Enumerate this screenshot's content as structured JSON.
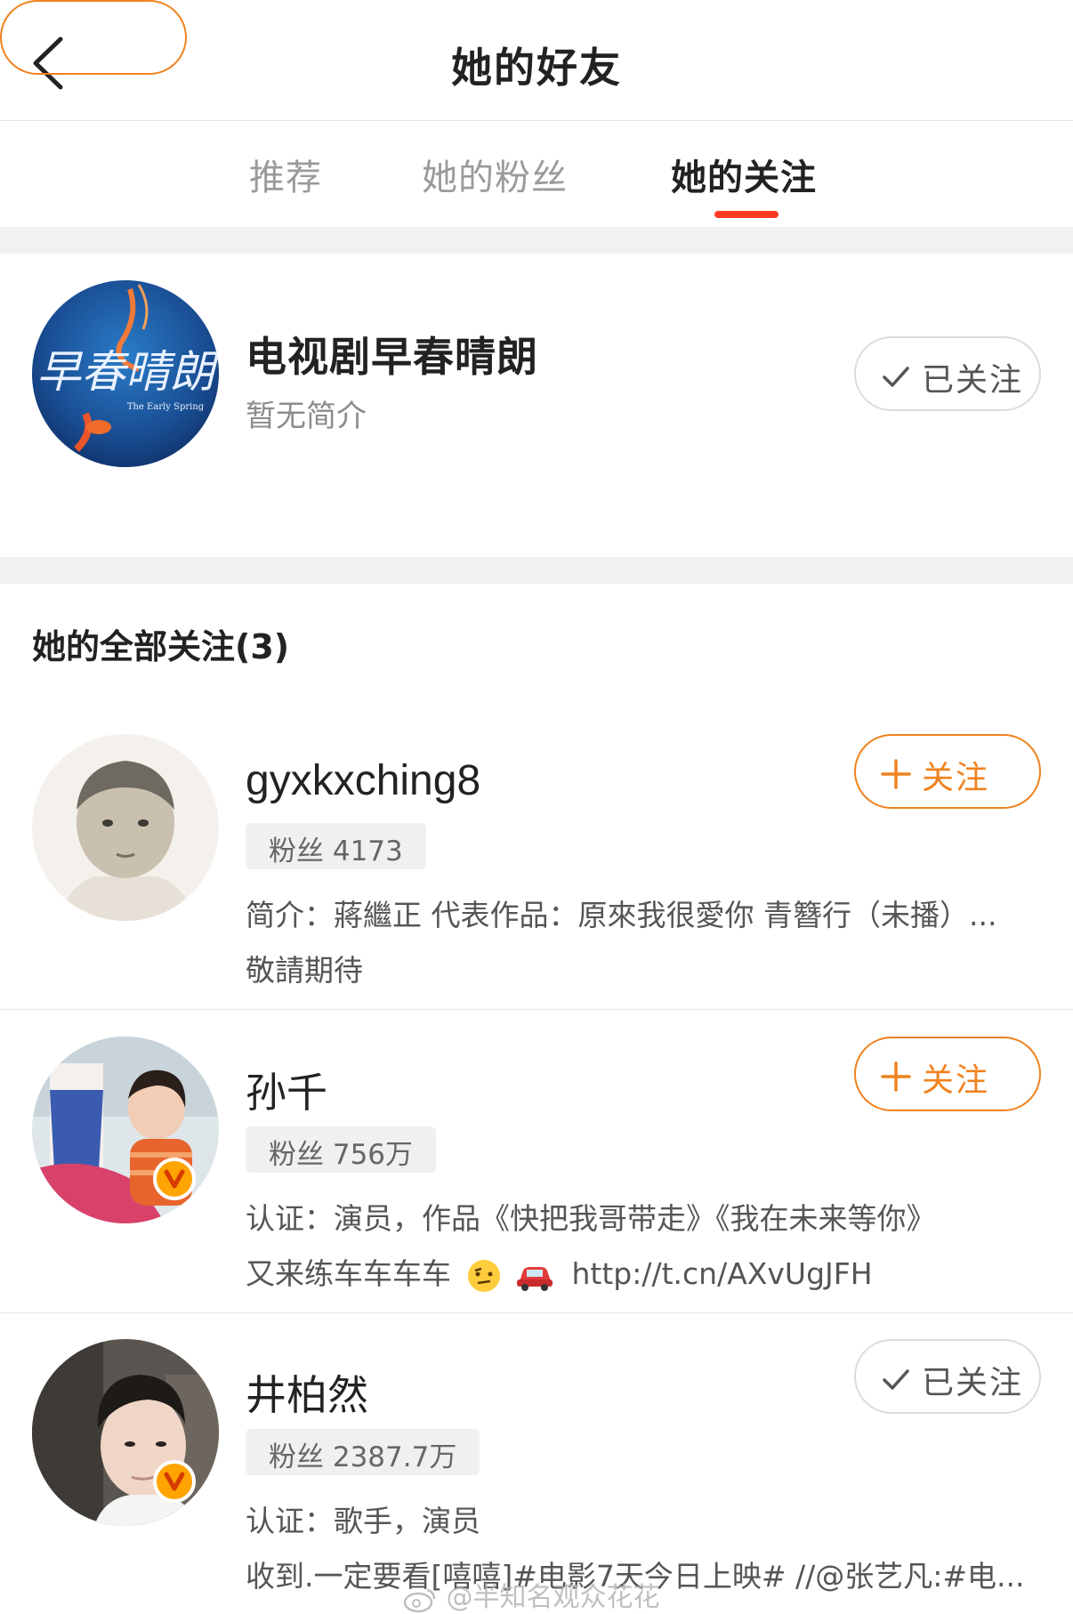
{
  "header": {
    "title": "她的好友",
    "back_icon": "chevron-left-icon"
  },
  "tabs": [
    {
      "label": "推荐",
      "active": false
    },
    {
      "label": "她的粉丝",
      "active": false
    },
    {
      "label": "她的关注",
      "active": true
    }
  ],
  "colors": {
    "accent": "#ff3a22",
    "follow_orange": "#f0821e",
    "verified_badge": "#ffa400"
  },
  "featured": {
    "name": "电视剧早春晴朗",
    "intro": "暂无简介",
    "avatar_text": "早春晴朗",
    "avatar_subtext": "The Early Spring",
    "button_label": "已关注",
    "button_icon": "check-icon"
  },
  "section_title": "她的全部关注(3)",
  "users": [
    {
      "name": "gyxkxching8",
      "fans": "粉丝 4173",
      "desc_line1": "简介：蔣繼正 代表作品：原來我很愛你 青簪行（未播）...",
      "desc_line2": "敬請期待",
      "button_label": "关注",
      "button_icon": "plus-icon",
      "verified": false
    },
    {
      "name": "孙千",
      "fans": "粉丝 756万",
      "desc_line1": "认证：演员，作品《快把我哥带走》《我在未来等你》",
      "desc_line2": "又来练车车车车",
      "desc_line2_link": "http://t.cn/AXvUgJFH",
      "button_label": "关注",
      "button_icon": "plus-icon",
      "verified": true
    },
    {
      "name": "井柏然",
      "fans": "粉丝 2387.7万",
      "desc_line1": "认证：歌手，演员",
      "desc_line2": "收到.一定要看[嘻嘻]#电影7天今日上映# //@张艺凡:#电...",
      "button_label": "已关注",
      "button_icon": "check-icon",
      "verified": true
    }
  ],
  "watermark": "@半知名观众花花"
}
